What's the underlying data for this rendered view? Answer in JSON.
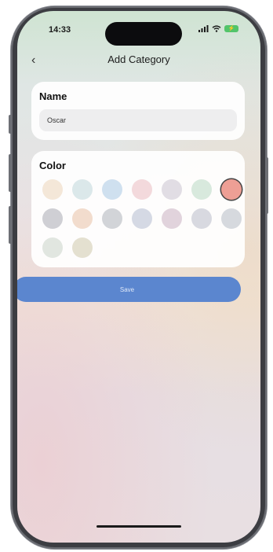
{
  "status_bar": {
    "time": "14:33",
    "signal_icon": "signal-bars-icon",
    "wifi_icon": "wifi-icon",
    "battery_icon": "battery-charging-icon"
  },
  "nav": {
    "back_icon": "chevron-left-icon",
    "back_glyph": "‹",
    "title": "Add Category"
  },
  "name_section": {
    "label": "Name",
    "value": "Oscar"
  },
  "color_section": {
    "label": "Color",
    "swatches": [
      {
        "color": "#f4e7d8",
        "selected": false
      },
      {
        "color": "#dbe8ea",
        "selected": false
      },
      {
        "color": "#cfe0ef",
        "selected": false
      },
      {
        "color": "#f3d9dc",
        "selected": false
      },
      {
        "color": "#e1dde4",
        "selected": false
      },
      {
        "color": "#d8e9dd",
        "selected": false
      },
      {
        "color": "#ee9f95",
        "selected": true
      },
      {
        "color": "#cfcfd4",
        "selected": false
      },
      {
        "color": "#f2dccd",
        "selected": false
      },
      {
        "color": "#d2d4d8",
        "selected": false
      },
      {
        "color": "#d5d9e4",
        "selected": false
      },
      {
        "color": "#e1d3dc",
        "selected": false
      },
      {
        "color": "#d8d9e0",
        "selected": false
      },
      {
        "color": "#d6d9de",
        "selected": false
      },
      {
        "color": "#e1e6e0",
        "selected": false
      },
      {
        "color": "#e4e0d0",
        "selected": false
      }
    ]
  },
  "save_button": {
    "label": "Save",
    "color": "#5b86cf"
  }
}
